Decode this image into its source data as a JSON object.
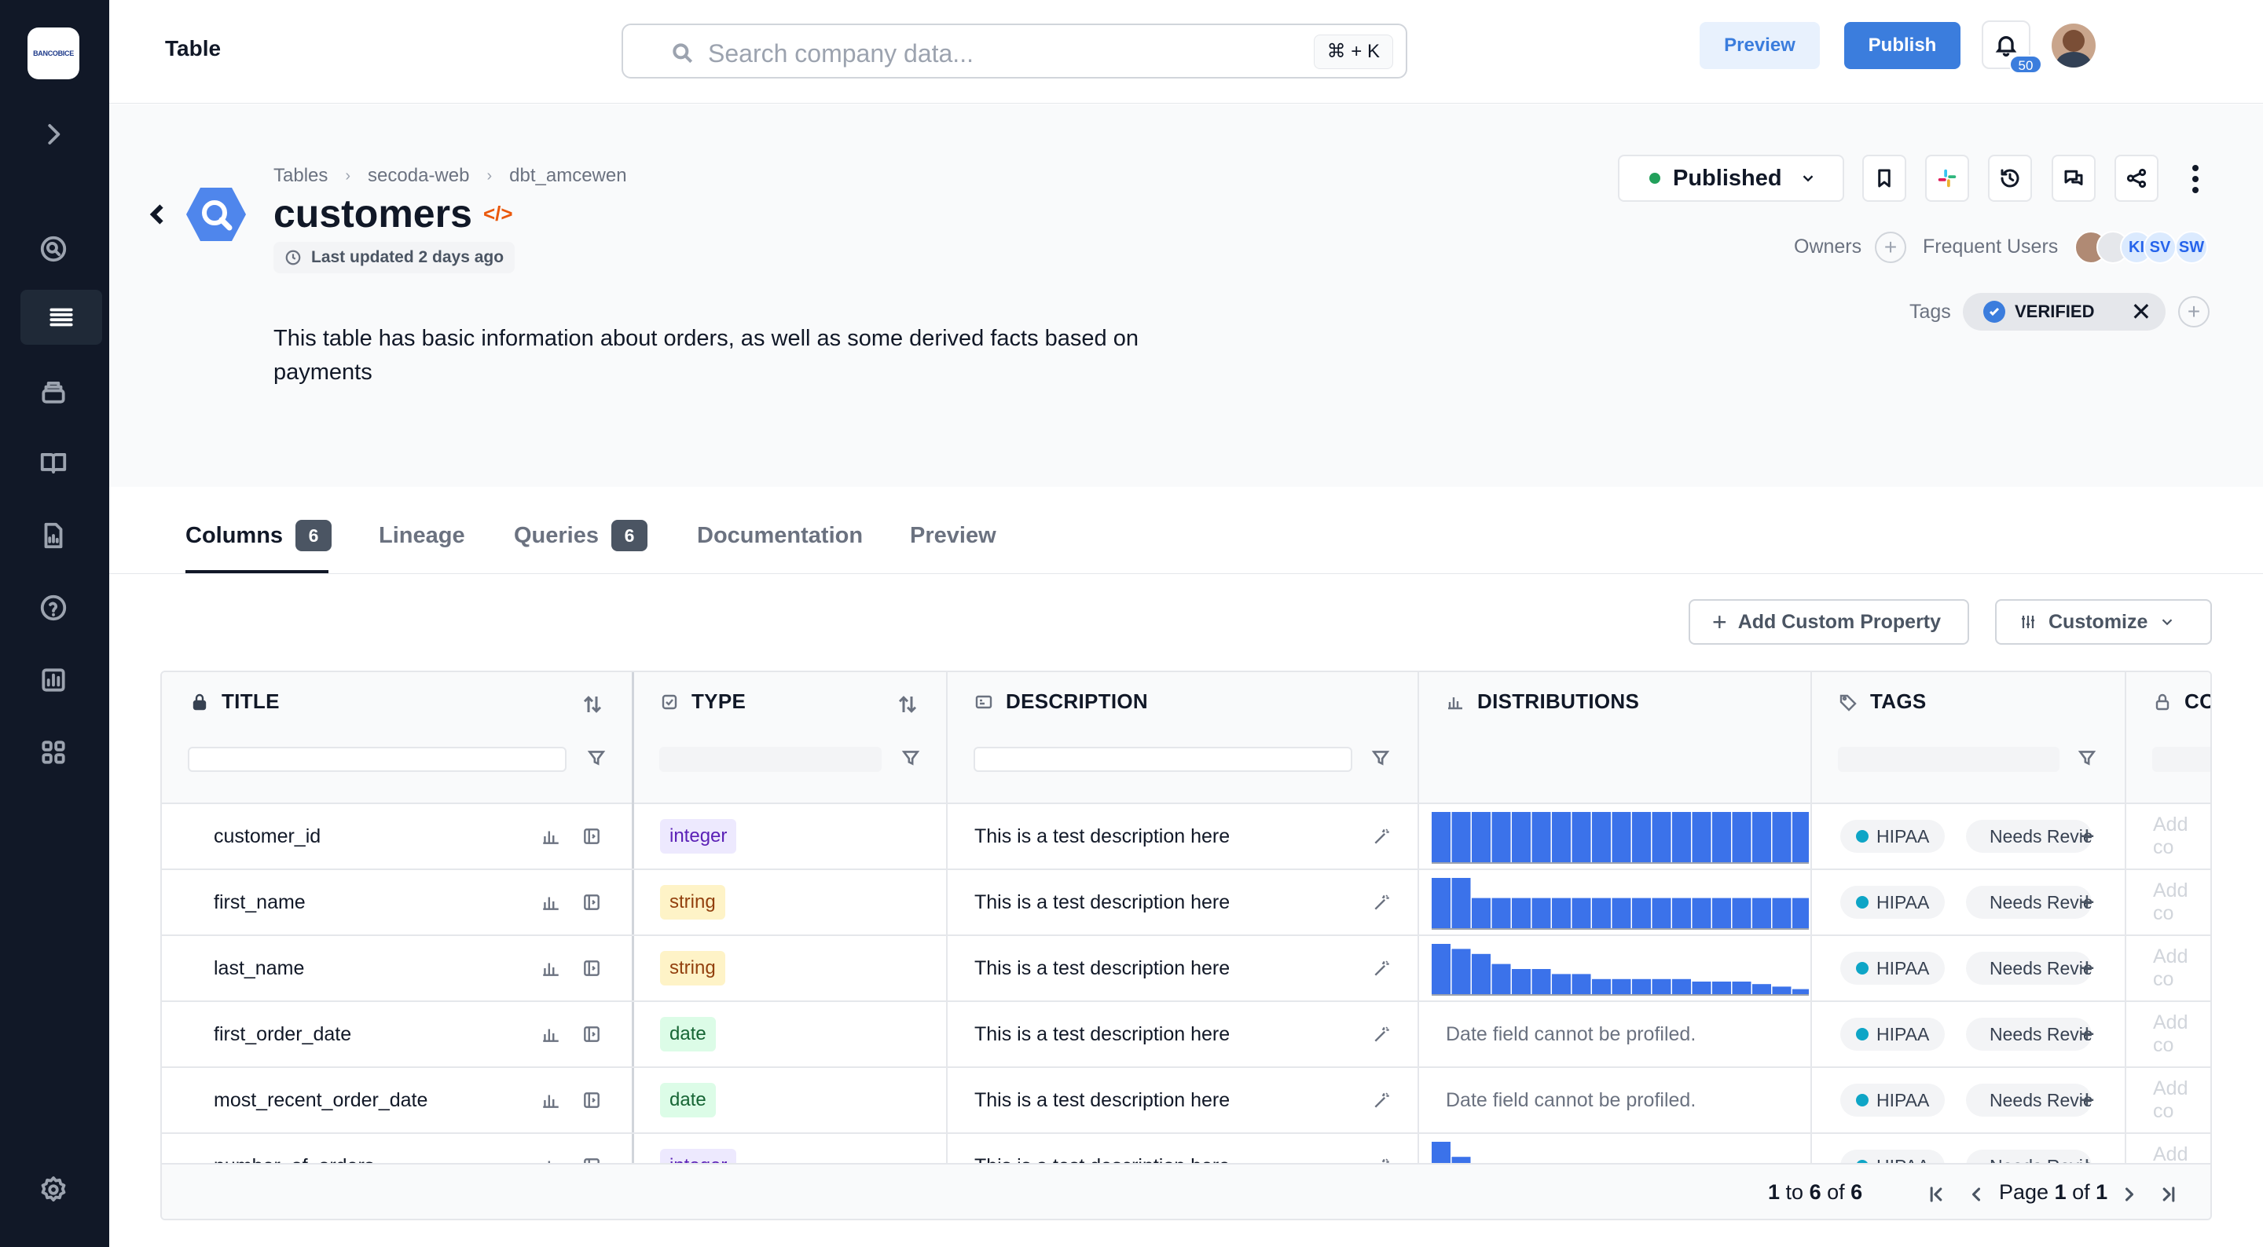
{
  "sidebar": {
    "logo_text": "BANCOBICE",
    "items": [
      {
        "icon": "expand-chevron-icon"
      },
      {
        "icon": "search-circle-icon"
      },
      {
        "icon": "list-icon",
        "active": true
      },
      {
        "icon": "database-icon"
      },
      {
        "icon": "book-icon"
      },
      {
        "icon": "report-icon"
      },
      {
        "icon": "help-icon"
      },
      {
        "icon": "chart-icon"
      },
      {
        "icon": "grid-icon"
      },
      {
        "icon": "settings-icon"
      }
    ]
  },
  "topbar": {
    "title": "Table",
    "search_placeholder": "Search company data...",
    "shortcut": "⌘ + K",
    "preview_label": "Preview",
    "publish_label": "Publish",
    "notification_count": "50"
  },
  "resource": {
    "breadcrumbs": [
      "Tables",
      "secoda-web",
      "dbt_amcewen"
    ],
    "title": "customers",
    "code_symbol": "</>",
    "updated": "Last updated 2 days ago",
    "description": "This table has basic information about orders, as well as some derived facts based on payments",
    "status": "Published",
    "owners_label": "Owners",
    "frequent_users_label": "Frequent Users",
    "frequent_users": [
      "KI",
      "SV",
      "SW"
    ],
    "tags_label": "Tags",
    "tags": [
      "VERIFIED"
    ]
  },
  "tabs": [
    {
      "label": "Columns",
      "count": "6",
      "active": true
    },
    {
      "label": "Lineage"
    },
    {
      "label": "Queries",
      "count": "6"
    },
    {
      "label": "Documentation"
    },
    {
      "label": "Preview"
    }
  ],
  "actions": {
    "add_property": "Add Custom Property",
    "customize": "Customize"
  },
  "table": {
    "headers": [
      "TITLE",
      "TYPE",
      "DESCRIPTION",
      "DISTRIBUTIONS",
      "TAGS",
      "CO"
    ],
    "rows": [
      {
        "title": "customer_id",
        "type": "integer",
        "description": "This is a test description here",
        "dist": [
          10,
          10,
          10,
          10,
          10,
          10,
          10,
          10,
          10,
          10,
          10,
          10,
          10,
          10,
          10,
          10,
          10,
          10,
          10,
          10
        ],
        "dist_note": "",
        "tags": [
          "HIPAA",
          "Needs Review"
        ],
        "co": "Add co"
      },
      {
        "title": "first_name",
        "type": "string",
        "description": "This is a test description here",
        "dist": [
          10,
          10,
          6,
          6,
          6,
          6,
          6,
          6,
          6,
          6,
          6,
          6,
          6,
          6,
          6,
          6,
          6,
          6,
          6,
          3
        ],
        "dist_note": "",
        "tags": [
          "HIPAA",
          "Needs Review"
        ],
        "co": "Add co"
      },
      {
        "title": "last_name",
        "type": "string",
        "description": "This is a test description here",
        "dist": [
          10,
          9,
          8,
          6,
          5,
          5,
          4,
          4,
          3,
          3,
          3,
          3,
          3,
          2.5,
          2.5,
          2.5,
          2,
          1.5,
          1,
          0.5
        ],
        "dist_note": "",
        "tags": [
          "HIPAA",
          "Needs Review"
        ],
        "co": "Add co"
      },
      {
        "title": "first_order_date",
        "type": "date",
        "description": "This is a test description here",
        "dist": [],
        "dist_note": "Date field cannot be profiled.",
        "tags": [
          "HIPAA",
          "Needs Review"
        ],
        "co": "Add co"
      },
      {
        "title": "most_recent_order_date",
        "type": "date",
        "description": "This is a test description here",
        "dist": [],
        "dist_note": "Date field cannot be profiled.",
        "tags": [
          "HIPAA",
          "Needs Review"
        ],
        "co": "Add co"
      },
      {
        "title": "number_of_orders",
        "type": "integer",
        "description": "This is a test description here",
        "dist": [
          10,
          7,
          2
        ],
        "dist_note": "",
        "tags": [
          "HIPAA",
          "Needs Review"
        ],
        "co": "Add co"
      }
    ],
    "pagination": {
      "from": "1",
      "to": "6",
      "total": "6",
      "page": "1",
      "pages": "1"
    }
  },
  "colors": {
    "accent": "#3b7ddd",
    "bar": "#3b72ea",
    "hipaa": "#0ea5c6",
    "needs_review": "#ea7a2a",
    "published": "#22a05b"
  }
}
